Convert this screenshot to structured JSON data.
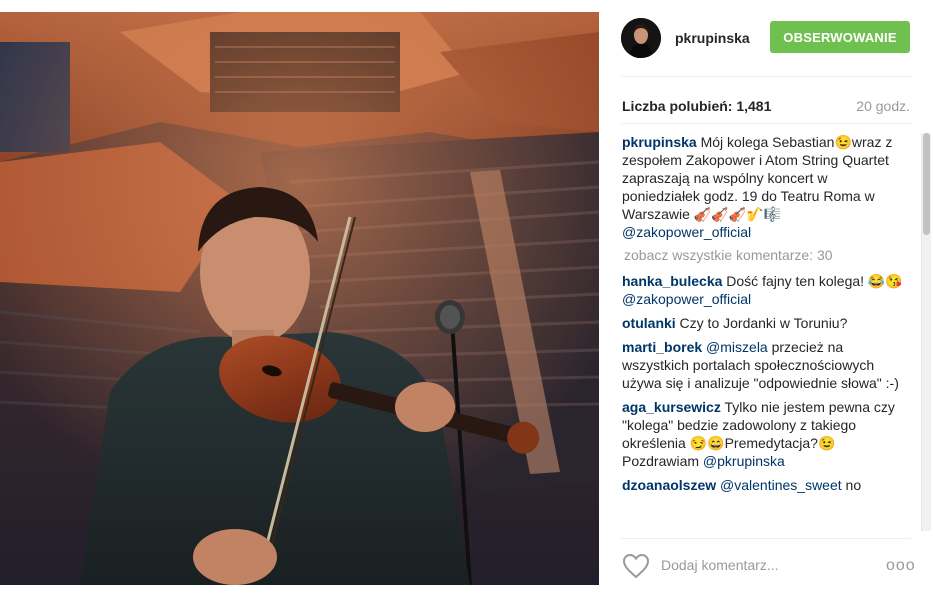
{
  "post": {
    "username": "pkrupinska",
    "follow_label": "OBSERWOWANIE",
    "likes_text": "Liczba polubień: 1,481",
    "time_ago": "20 godz.",
    "view_all_comments": "zobacz wszystkie komentarze: 30",
    "add_comment_placeholder": "Dodaj komentarz...",
    "more_options": "ooo",
    "image_alt": "Violinist playing in a concert hall",
    "mic_label": "microphone"
  },
  "caption": {
    "user": "pkrupinska",
    "text": " Mój kolega Sebastian😉wraz z zespołem Zakopower i Atom String Quartet zapraszają na wspólny koncert w poniedziałek godz. 19 do Teatru Roma w Warszawie 🎻🎻🎻🎷🎼",
    "mention": "@zakopower_official"
  },
  "comments": [
    {
      "user": "hanka_bulecka",
      "text": " Dość fajny ten kolega! 😂😘 ",
      "mention": "@zakopower_official",
      "after": ""
    },
    {
      "user": "otulanki",
      "text": " Czy to Jordanki w Toruniu?",
      "mention": "",
      "after": ""
    },
    {
      "user": "marti_borek",
      "text": " ",
      "mention": "@miszela",
      "after": " przecież na wszystkich portalach społecznościowych używa się i analizuje \"odpowiednie słowa\" :-)"
    },
    {
      "user": "aga_kursewicz",
      "text": " Tylko nie jestem pewna czy \"kolega\" bedzie zadowolony z takiego określenia 😏😄Premedytacja?😉Pozdrawiam ",
      "mention": "@pkrupinska",
      "after": ""
    },
    {
      "user": "dzoanaolszew",
      "text": " ",
      "mention": "@valentines_sweet",
      "after": " no"
    }
  ],
  "colors": {
    "follow_green": "#70c050",
    "link_blue": "#003569",
    "muted_gray": "#999999"
  },
  "icons": {
    "heart": "heart-outline-icon",
    "more": "ellipsis-icon"
  }
}
